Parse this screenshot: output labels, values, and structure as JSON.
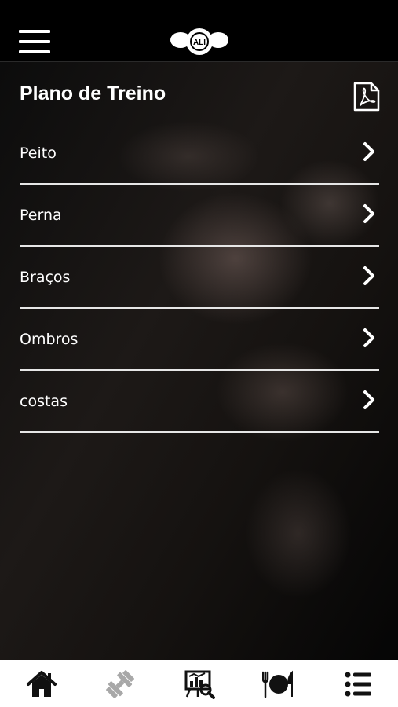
{
  "app": {
    "logo_text": "ALI"
  },
  "page": {
    "title": "Plano de Treino"
  },
  "menu": {
    "items": [
      {
        "label": "Peito"
      },
      {
        "label": "Perna"
      },
      {
        "label": "Braços"
      },
      {
        "label": "Ombros"
      },
      {
        "label": "costas"
      }
    ]
  },
  "icons": {
    "menu": "hamburger-menu-icon",
    "pdf": "pdf-document-icon",
    "chevron": "chevron-right-icon",
    "tabs": [
      "home-icon",
      "dumbbell-icon",
      "progress-chart-icon",
      "meal-icon",
      "list-icon"
    ]
  },
  "colors": {
    "topbar": "#000000",
    "tabbar": "#ffffff",
    "active_tab": "#111111",
    "inactive_tab": "#a8a8a8",
    "status_indicator": "#2ecc40"
  }
}
